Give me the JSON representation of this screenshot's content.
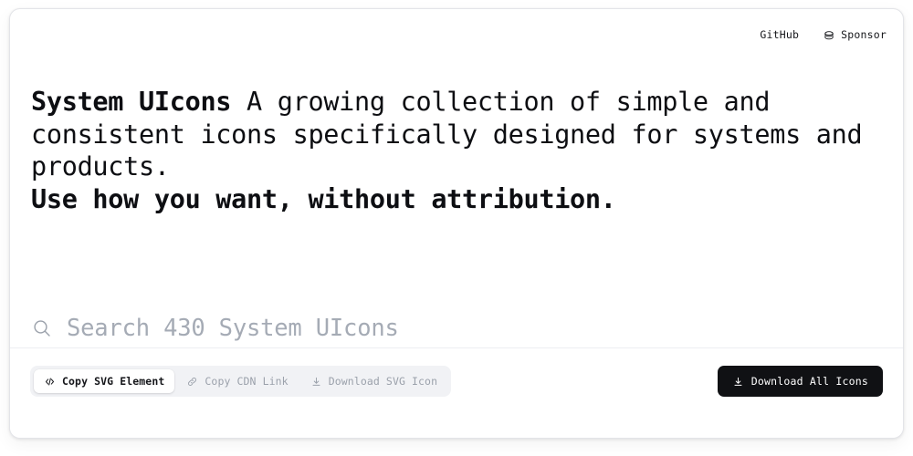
{
  "header": {
    "links": [
      {
        "label": "GitHub",
        "icon": "github-text-link"
      },
      {
        "label": "Sponsor",
        "icon": "coins-stack-icon"
      }
    ]
  },
  "hero": {
    "title": "System UIcons",
    "description": "A growing collection of simple and consistent icons specifically designed for systems and products.",
    "tagline": "Use how you want, without attribution."
  },
  "search": {
    "placeholder": "Search 430 System UIcons",
    "value": "",
    "icon": "search-icon",
    "icon_count": "430"
  },
  "actions": {
    "segmented": [
      {
        "label": "Copy SVG Element",
        "icon": "code-icon",
        "active": true
      },
      {
        "label": "Copy CDN Link",
        "icon": "link-icon",
        "active": false
      },
      {
        "label": "Download SVG Icon",
        "icon": "download-icon",
        "active": false
      }
    ],
    "download_all": {
      "label": "Download All Icons",
      "icon": "download-icon"
    }
  },
  "colors": {
    "text": "#0d0e12",
    "muted": "#9ba1ab",
    "placeholder": "#a5abb5",
    "segment_bg": "#f1f2f5",
    "button_bg": "#101114",
    "divider": "#edeef1",
    "card_border": "#e3e4e8"
  }
}
